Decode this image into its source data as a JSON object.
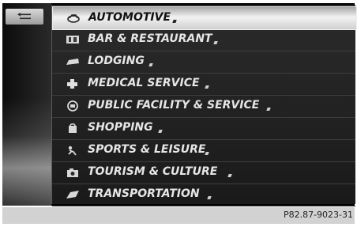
{
  "sidebar": {
    "back_icon": "back-arrow-icon"
  },
  "categories": [
    {
      "label": "AUTOMOTIVE",
      "icon": "car-icon",
      "selected": true
    },
    {
      "label": "BAR & RESTAURANT",
      "icon": "restaurant-icon",
      "selected": false
    },
    {
      "label": "LODGING",
      "icon": "bed-icon",
      "selected": false
    },
    {
      "label": "MEDICAL SERVICE",
      "icon": "medical-cross-icon",
      "selected": false
    },
    {
      "label": "PUBLIC FACILITY & SERVICE",
      "icon": "public-building-icon",
      "selected": false
    },
    {
      "label": "SHOPPING",
      "icon": "shopping-bag-icon",
      "selected": false
    },
    {
      "label": "SPORTS & LEISURE",
      "icon": "sports-icon",
      "selected": false
    },
    {
      "label": "TOURISM & CULTURE",
      "icon": "camera-icon",
      "selected": false
    },
    {
      "label": "TRANSPORTATION",
      "icon": "transportation-icon",
      "selected": false
    }
  ],
  "footer": {
    "caption": "P82.87-9023-31"
  }
}
